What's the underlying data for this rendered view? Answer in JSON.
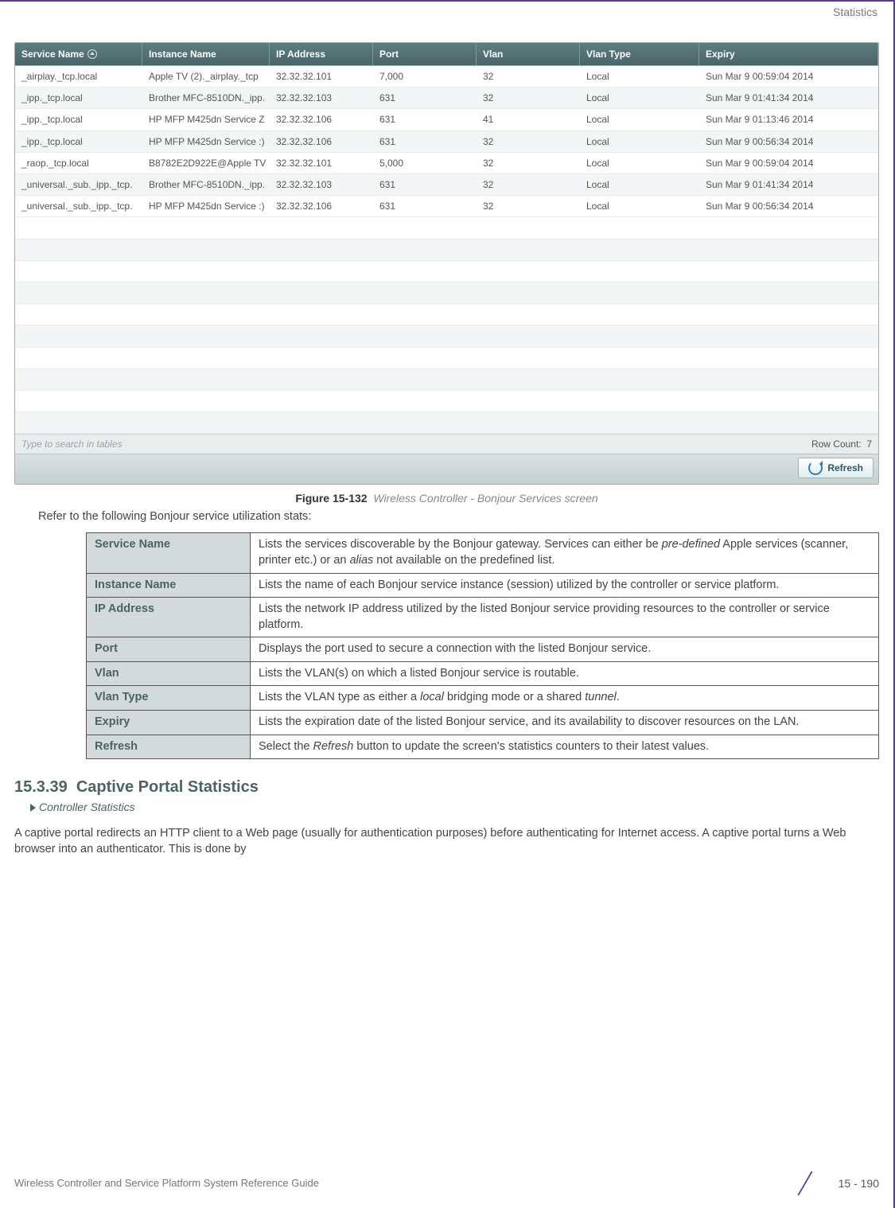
{
  "header": {
    "section": "Statistics"
  },
  "screenshot": {
    "columns": [
      "Service Name",
      "Instance Name",
      "IP Address",
      "Port",
      "Vlan",
      "Vlan Type",
      "Expiry"
    ],
    "rows": [
      {
        "sn": "_airplay._tcp.local",
        "in": "Apple TV (2)._airplay._tcp",
        "ip": "32.32.32.101",
        "port": "7,000",
        "vlan": "32",
        "vt": "Local",
        "ex": "Sun Mar  9 00:59:04 2014"
      },
      {
        "sn": "_ipp._tcp.local",
        "in": "Brother MFC-8510DN._ipp.",
        "ip": "32.32.32.103",
        "port": "631",
        "vlan": "32",
        "vt": "Local",
        "ex": "Sun Mar  9 01:41:34 2014"
      },
      {
        "sn": "_ipp._tcp.local",
        "in": "HP MFP M425dn Service Z",
        "ip": "32.32.32.106",
        "port": "631",
        "vlan": "41",
        "vt": "Local",
        "ex": "Sun Mar  9 01:13:46 2014"
      },
      {
        "sn": "_ipp._tcp.local",
        "in": "HP MFP M425dn Service :)",
        "ip": "32.32.32.106",
        "port": "631",
        "vlan": "32",
        "vt": "Local",
        "ex": "Sun Mar  9 00:56:34 2014"
      },
      {
        "sn": "_raop._tcp.local",
        "in": "B8782E2D922E@Apple TV",
        "ip": "32.32.32.101",
        "port": "5,000",
        "vlan": "32",
        "vt": "Local",
        "ex": "Sun Mar  9 00:59:04 2014"
      },
      {
        "sn": "_universal._sub._ipp._tcp.",
        "in": "Brother MFC-8510DN._ipp.",
        "ip": "32.32.32.103",
        "port": "631",
        "vlan": "32",
        "vt": "Local",
        "ex": "Sun Mar  9 01:41:34 2014"
      },
      {
        "sn": "_universal._sub._ipp._tcp.",
        "in": "HP MFP M425dn Service :)",
        "ip": "32.32.32.106",
        "port": "631",
        "vlan": "32",
        "vt": "Local",
        "ex": "Sun Mar  9 00:56:34 2014"
      }
    ],
    "search_placeholder": "Type to search in tables",
    "row_count_label": "Row Count:",
    "row_count_value": "7",
    "refresh_label": "Refresh"
  },
  "figure": {
    "number": "Figure 15-132",
    "caption": "Wireless Controller - Bonjour Services screen"
  },
  "intro_text": "Refer to the following Bonjour service utilization stats:",
  "definitions": [
    {
      "term": "Service Name",
      "desc": "Lists the services discoverable by the Bonjour gateway. Services can either be <i>pre-defined</i> Apple services (scanner, printer etc.) or an <i>alias</i> not available on the predefined list."
    },
    {
      "term": "Instance Name",
      "desc": "Lists the name of each Bonjour service instance (session) utilized by the controller or service platform."
    },
    {
      "term": "IP Address",
      "desc": "Lists the network IP address utilized by the listed Bonjour service providing resources to the controller or service platform."
    },
    {
      "term": "Port",
      "desc": "Displays the port used to secure a connection with the listed Bonjour service."
    },
    {
      "term": "Vlan",
      "desc": "Lists the VLAN(s) on which a listed Bonjour service is routable."
    },
    {
      "term": "Vlan Type",
      "desc": "Lists the VLAN type as either a <i>local</i> bridging mode or a shared <i>tunnel</i>."
    },
    {
      "term": "Expiry",
      "desc": "Lists the expiration date of the listed Bonjour service, and its availability to discover resources on the LAN."
    },
    {
      "term": "Refresh",
      "desc": "Select the <i>Refresh</i> button to update the screen's statistics counters to their latest values."
    }
  ],
  "section": {
    "number": "15.3.39",
    "title": "Captive Portal Statistics",
    "breadcrumb": "Controller Statistics",
    "paragraph": "A captive portal redirects an HTTP client to a Web page (usually for authentication purposes) before authenticating for Internet access. A captive portal turns a Web browser into an authenticator. This is done by"
  },
  "footer": {
    "guide": "Wireless Controller and Service Platform System Reference Guide",
    "page": "15 - 190"
  }
}
